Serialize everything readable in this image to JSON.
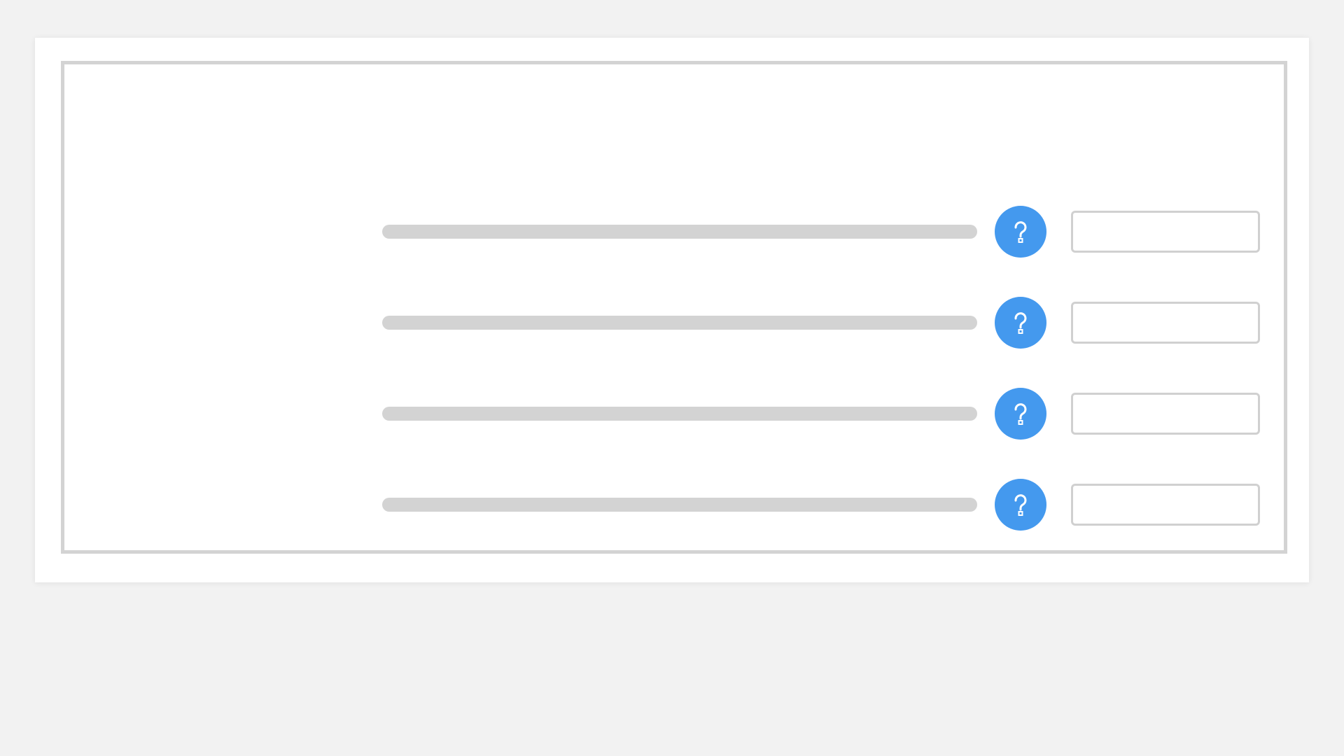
{
  "colors": {
    "background": "#f2f2f2",
    "card": "#ffffff",
    "frame_border": "#d3d3d3",
    "bar": "#d3d3d3",
    "accent": "#4499ee",
    "field_border": "#d0d0d0"
  },
  "rows": [
    {
      "icon": "question-mark-icon",
      "field_value": "",
      "field_placeholder": ""
    },
    {
      "icon": "question-mark-icon",
      "field_value": "",
      "field_placeholder": ""
    },
    {
      "icon": "question-mark-icon",
      "field_value": "",
      "field_placeholder": ""
    },
    {
      "icon": "question-mark-icon",
      "field_value": "",
      "field_placeholder": ""
    }
  ]
}
